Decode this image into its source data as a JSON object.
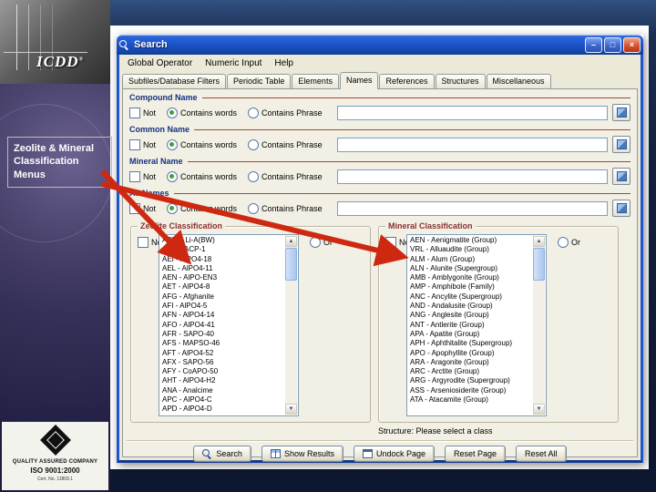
{
  "slide": {
    "label_box": "Zeolite & Mineral Classification Menus",
    "logo_text": "ICDD",
    "logo_reg": "®",
    "cert": {
      "line1": "QUALITY ASSURED COMPANY",
      "line2": "ISO 9001:2000",
      "line3": "Cert. No. 11809.1"
    }
  },
  "window": {
    "title": "Search",
    "controls": {
      "minimize": "–",
      "maximize": "□",
      "close": "×"
    }
  },
  "menu": {
    "items": [
      {
        "label": "Global Operator"
      },
      {
        "label": "Numeric Input"
      },
      {
        "label": "Help"
      }
    ]
  },
  "tabs": {
    "active": "Names",
    "items": [
      {
        "label": "Subfiles/Database Filters"
      },
      {
        "label": "Periodic Table"
      },
      {
        "label": "Elements"
      },
      {
        "label": "Names",
        "active": true
      },
      {
        "label": "References"
      },
      {
        "label": "Structures"
      },
      {
        "label": "Miscellaneous"
      }
    ]
  },
  "controls": {
    "not_label": "Not",
    "contains_words": "Contains words",
    "contains_phrase": "Contains Phrase",
    "or_label": "Or"
  },
  "name_sections": {
    "items": [
      {
        "label": "Compound Name"
      },
      {
        "label": "Common Name"
      },
      {
        "label": "Mineral Name"
      },
      {
        "label": "All Names"
      }
    ]
  },
  "zeolite": {
    "title": "Zeolite Classification",
    "items": [
      "ABW - Li-A(BW)",
      "ACO - ACP-1",
      "AEI - AlPO4-18",
      "AEL - AlPO4-11",
      "AEN - AlPO-EN3",
      "AET - AlPO4-8",
      "AFG - Afghanite",
      "AFI - AlPO4-5",
      "AFN - AlPO4-14",
      "AFO - AlPO4-41",
      "AFR - SAPO-40",
      "AFS - MAPSO-46",
      "AFT - AlPO4-52",
      "AFX - SAPO-56",
      "AFY - CoAPO-50",
      "AHT - AlPO4-H2",
      "ANA - Analcime",
      "APC - AlPO4-C",
      "APD - AlPO4-D"
    ]
  },
  "mineral": {
    "title": "Mineral Classification",
    "items": [
      "AEN - Aenigmatite (Group)",
      "VRL - Alluaudite (Group)",
      "ALM - Alum (Group)",
      "ALN - Alunite (Supergroup)",
      "AMB - Amblygonite (Group)",
      "AMP - Amphibole (Family)",
      "ANC - Ancylite (Supergroup)",
      "AND - Andalusite (Group)",
      "ANG - Anglesite (Group)",
      "ANT - Antlerite (Group)",
      "APA - Apatite (Group)",
      "APH - Aphthitalite (Supergroup)",
      "APO - Apophyllite (Group)",
      "ARA - Aragonite (Group)",
      "ARC - Arctite (Group)",
      "ARG - Argyrodite (Supergroup)",
      "ASS - Arseniosiderite (Group)",
      "ATA - Atacamite (Group)"
    ]
  },
  "structure_note": "Structure: Please select a class",
  "scrollbar": {
    "up": "▲",
    "down": "▼"
  },
  "buttons": {
    "items": [
      {
        "label": "Search",
        "icon": "search-icon"
      },
      {
        "label": "Show Results",
        "icon": "results-icon"
      },
      {
        "label": "Undock Page",
        "icon": "undock-icon"
      },
      {
        "label": "Reset Page"
      },
      {
        "label": "Reset All"
      }
    ]
  },
  "colors": {
    "accent_arrow": "#cf2810",
    "titlebar": "#1e55cc",
    "close_button": "#d7502e"
  }
}
